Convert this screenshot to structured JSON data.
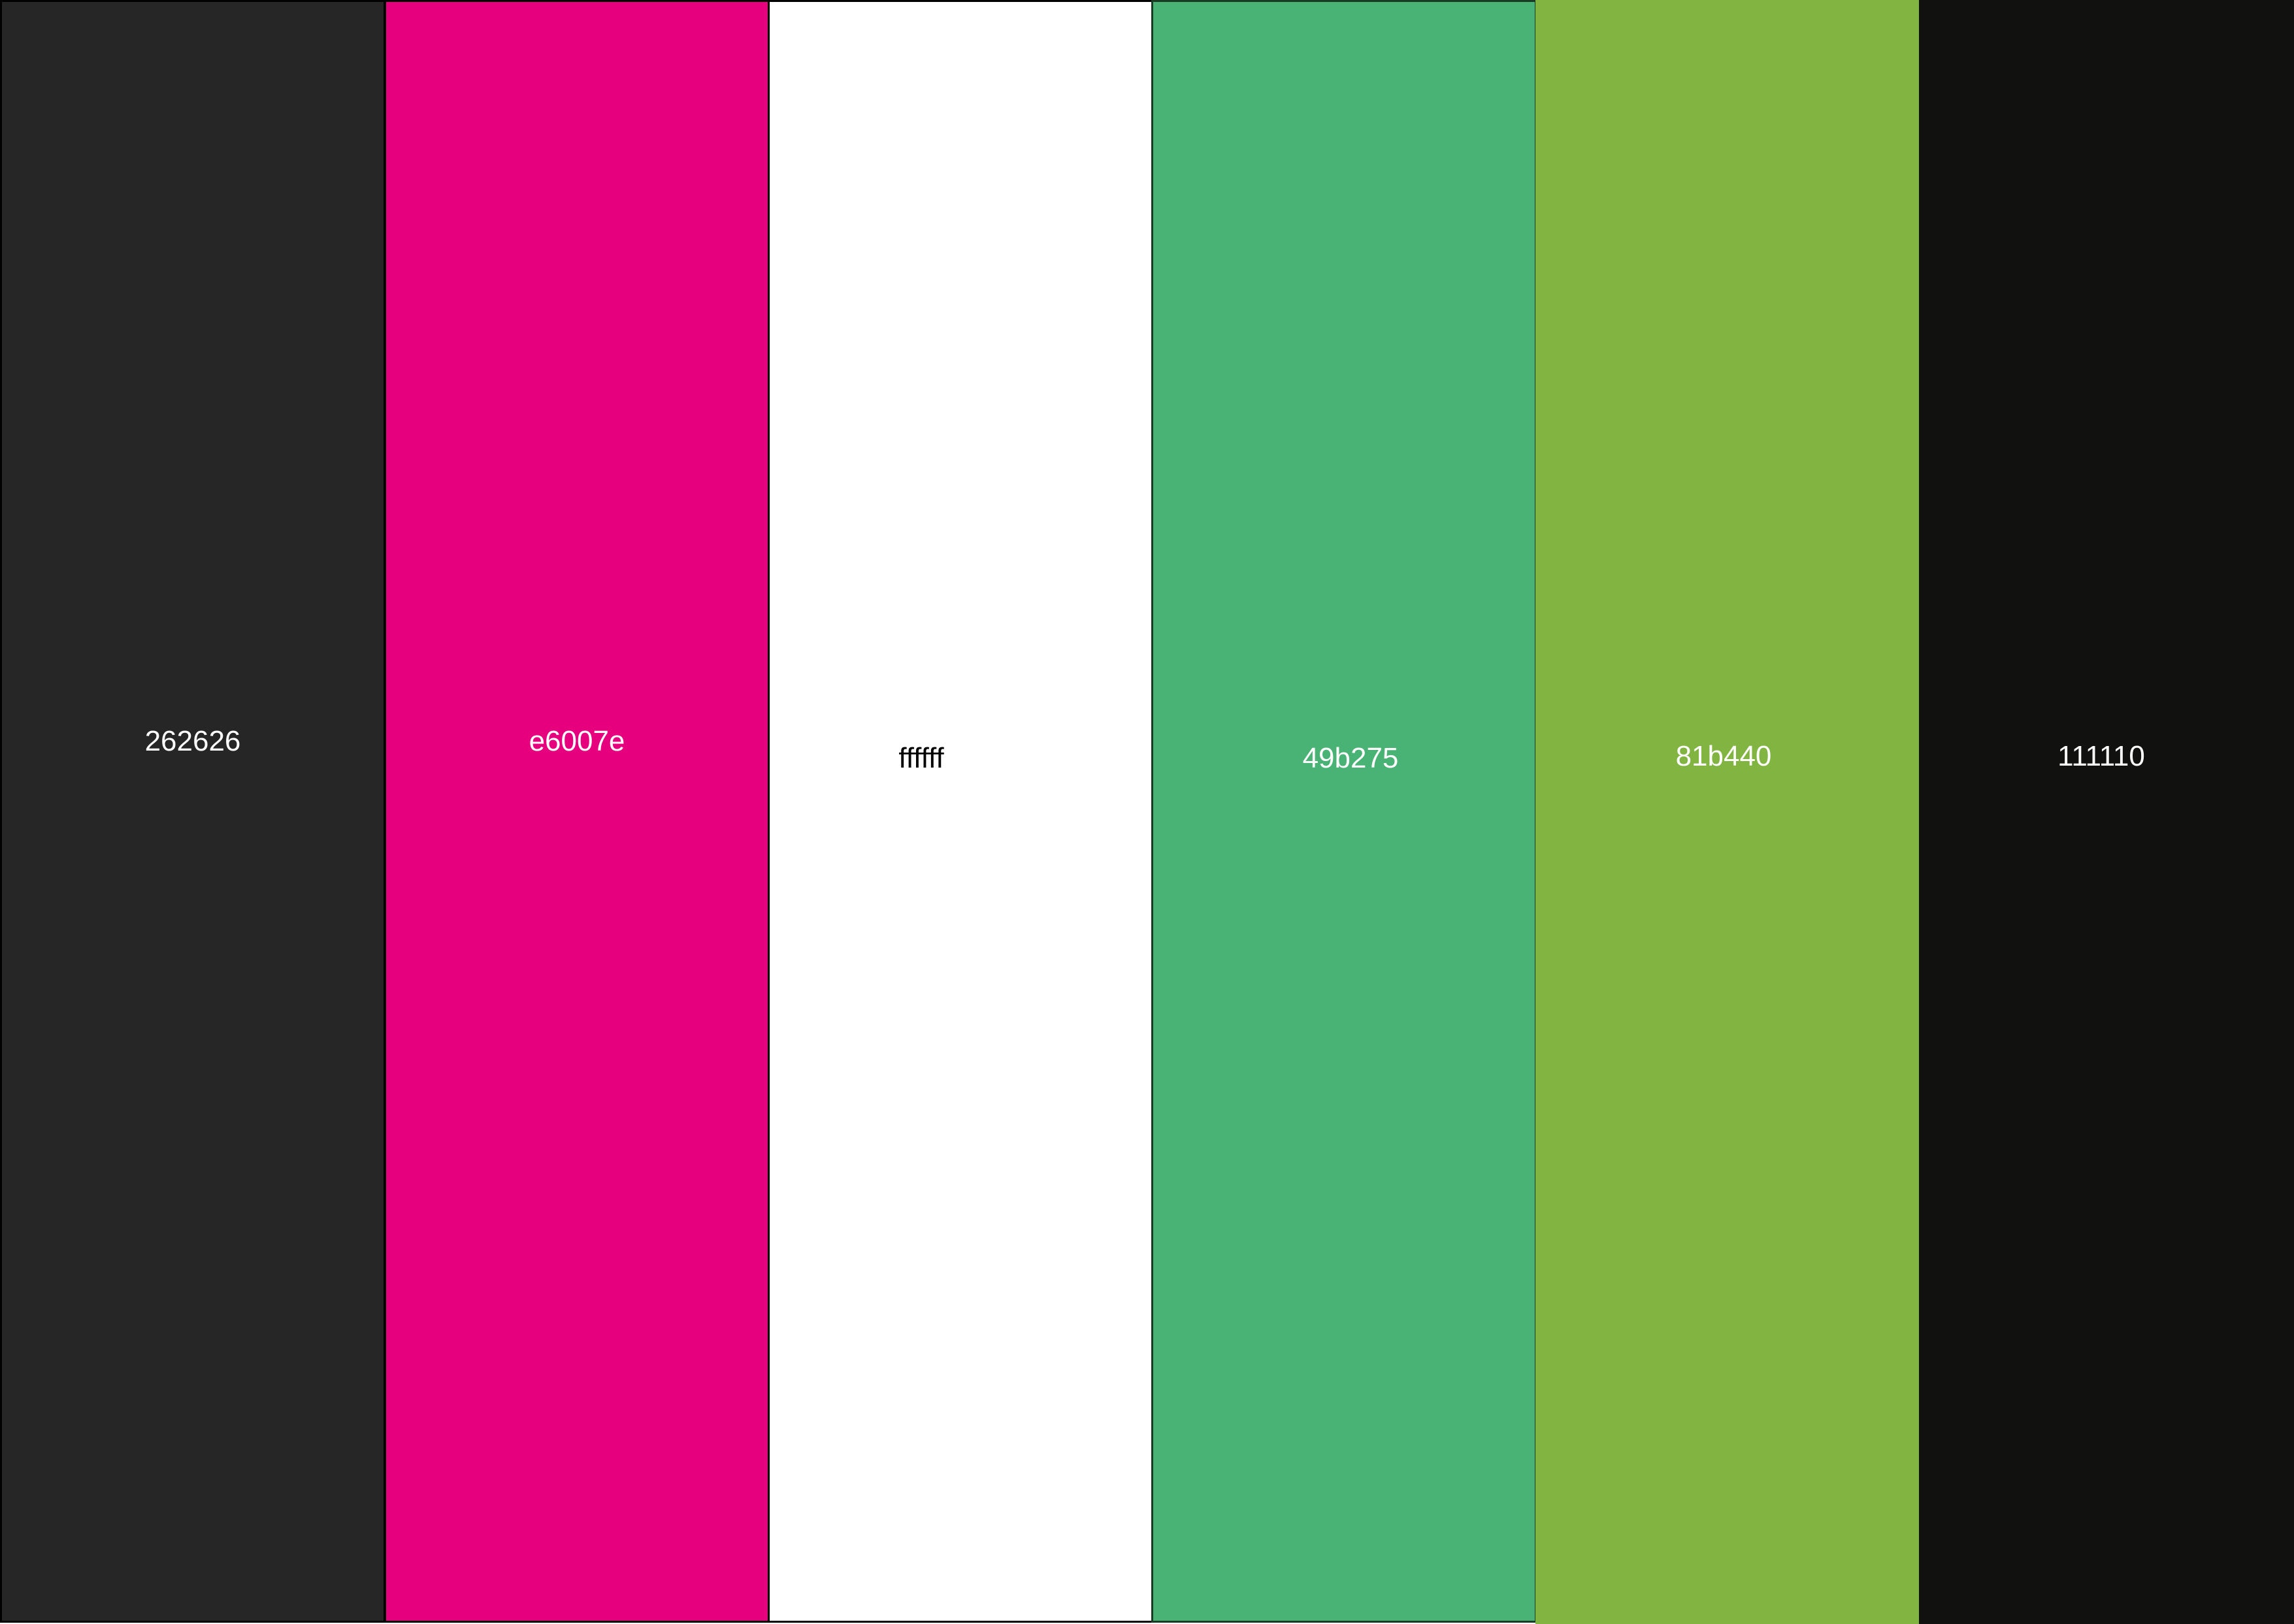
{
  "palette": {
    "swatches": [
      {
        "hex": "262626",
        "color": "#262626",
        "text_color": "#ffffff",
        "border": "#000000"
      },
      {
        "hex": "e6007e",
        "color": "#e6007e",
        "text_color": "#ffffff",
        "border": "#000000"
      },
      {
        "hex": "ffffff",
        "color": "#ffffff",
        "text_color": "#000000",
        "border": "#000000"
      },
      {
        "hex": "49b275",
        "color": "#49b275",
        "text_color": "#ffffff",
        "border": "#1a3a24"
      },
      {
        "hex": "81b440",
        "color": "#81b440",
        "text_color": "#ffffff",
        "border": "none"
      },
      {
        "hex": "111110",
        "color": "#111110",
        "text_color": "#ffffff",
        "border": "none"
      }
    ]
  }
}
